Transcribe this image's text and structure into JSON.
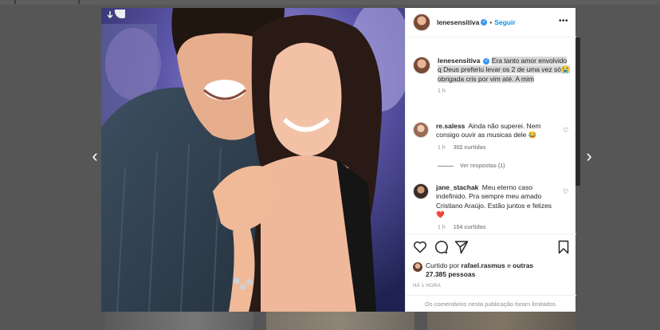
{
  "post": {
    "author": "lenesensitiva",
    "follow_label": "Seguir",
    "more_label": "•••",
    "caption_text": "Era tanto amor envolvido q Deus preferiu levar os 2 de uma vez só😭obrigada cris por vim até. A mim",
    "caption_time": "1 h"
  },
  "comments": [
    {
      "user": "re.saless",
      "text": "Ainda não superei. Nem consigo ouvir as musicas dele 😂",
      "time": "1 h",
      "likes": "302 curtidas",
      "replies": "Ver respostas (1)"
    },
    {
      "user": "jane_stachak",
      "text": "Meu eterno caso indefinido. Pra sempre meu amado Cristiano Araújo. Estão juntos e felizes ❤️",
      "time": "1 h",
      "likes": "154 curtidas"
    }
  ],
  "likes": {
    "prefix": "Curtido por ",
    "user": "rafael.rasmus",
    "middle": " e ",
    "others": "outras 27.385 pessoas"
  },
  "post_time": "HÁ 1 HORA",
  "comments_limited": "Os comentários nesta publicação foram limitados.",
  "nav": {
    "prev_glyph": "‹",
    "next_glyph": "›"
  },
  "icons": [
    "download-icon",
    "heart-icon",
    "comment-icon",
    "share-icon",
    "bookmark-icon",
    "verified-icon",
    "more-options-icon",
    "chevron-left-icon",
    "chevron-right-icon"
  ],
  "colors": {
    "accent": "#0095f6",
    "verified": "#3897f0",
    "reply_heart": "#ed4956",
    "overlay": "#565656",
    "muted_text": "#8e8e8e"
  }
}
